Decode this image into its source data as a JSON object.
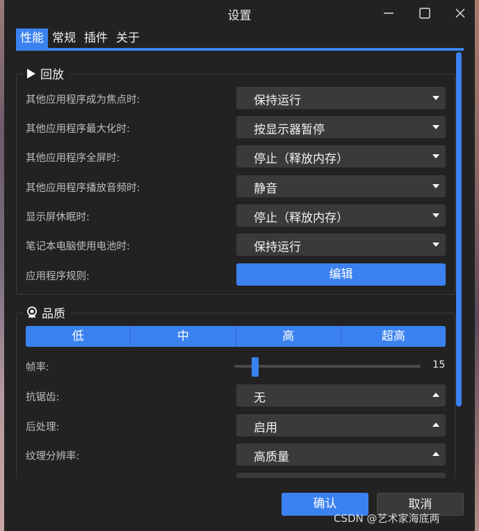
{
  "window": {
    "title": "设置"
  },
  "tabs": [
    {
      "label": "性能",
      "active": true
    },
    {
      "label": "常规",
      "active": false
    },
    {
      "label": "插件",
      "active": false
    },
    {
      "label": "关于",
      "active": false
    }
  ],
  "playback": {
    "title": "回放",
    "icon": "play-icon",
    "rows": [
      {
        "label": "其他应用程序成为焦点时:",
        "value": "保持运行"
      },
      {
        "label": "其他应用程序最大化时:",
        "value": "按显示器暂停"
      },
      {
        "label": "其他应用程序全屏时:",
        "value": "停止（释放内存）"
      },
      {
        "label": "其他应用程序播放音频时:",
        "value": "静音"
      },
      {
        "label": "显示屏休眠时:",
        "value": "停止（释放内存）"
      },
      {
        "label": "笔记本电脑使用电池时:",
        "value": "保持运行"
      }
    ],
    "rules_label": "应用程序规则:",
    "rules_button": "编辑"
  },
  "quality": {
    "title": "品质",
    "icon": "award-icon",
    "presets": [
      "低",
      "中",
      "高",
      "超高"
    ],
    "framerate_label": "帧率:",
    "framerate_value": "15",
    "rows": [
      {
        "label": "抗锯齿:",
        "value": "无"
      },
      {
        "label": "后处理:",
        "value": "启用"
      },
      {
        "label": "纹理分辨率:",
        "value": "高质量"
      }
    ]
  },
  "footer": {
    "ok": "确认",
    "cancel": "取消"
  },
  "watermark": "CSDN @艺术家海底两",
  "colors": {
    "accent": "#3b82f0",
    "background": "#222222",
    "control": "#3a3a3a"
  }
}
